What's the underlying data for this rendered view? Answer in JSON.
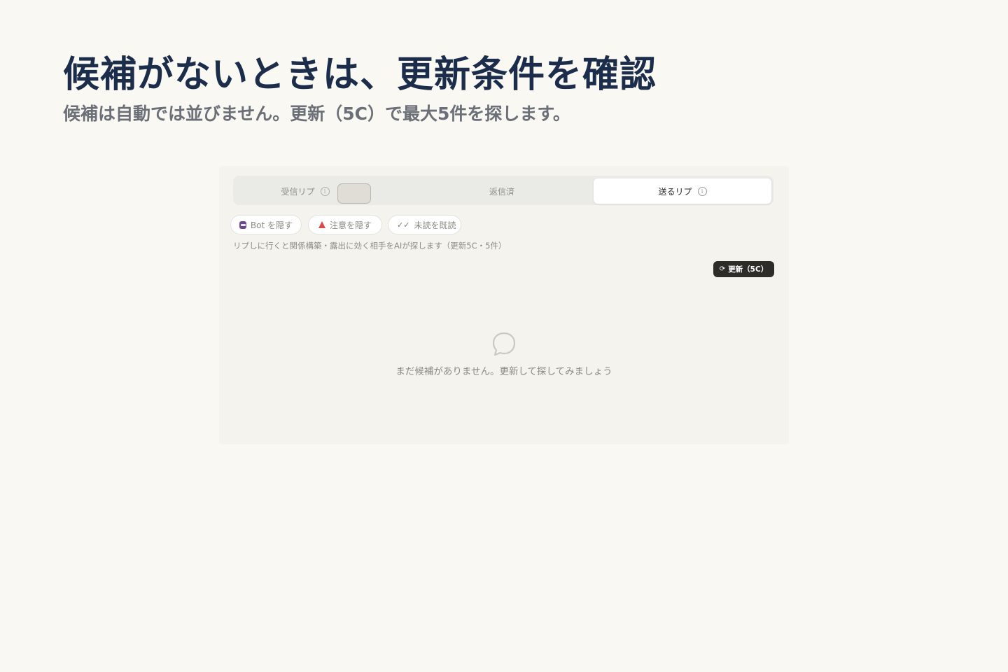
{
  "hero": {
    "title": "候補がないときは、更新条件を確認",
    "subtitle": "候補は自動では並びません。更新（5C）で最大5件を探します。"
  },
  "tabs": [
    {
      "label": "受信リプ",
      "icon": "info-icon",
      "selected": false
    },
    {
      "label": "返信済",
      "icon": null,
      "selected": false
    },
    {
      "label": "送るリプ",
      "icon": "info-icon",
      "selected": true
    }
  ],
  "filters": [
    {
      "label": "Bot を隠す",
      "icon": "bot-icon"
    },
    {
      "label": "注意を隠す",
      "icon": "warning-icon"
    },
    {
      "label": "未読を既読",
      "icon": "double-check-icon"
    }
  ],
  "description": "リプしに行くと関係構築・露出に効く相手をAIが探します（更新5C・5件）",
  "refresh_button": {
    "label": "更新（5C）",
    "icon": "refresh-icon"
  },
  "empty_state": {
    "icon": "chat-bubble-icon",
    "message": "まだ候補がありません。更新して探してみましょう"
  },
  "colors": {
    "page_background": "#faf8f2",
    "title": "#1b2d4a",
    "subtitle": "#6b6f78",
    "panel_background": "#f4f3ee",
    "refresh_button_background": "#2e2c29"
  }
}
